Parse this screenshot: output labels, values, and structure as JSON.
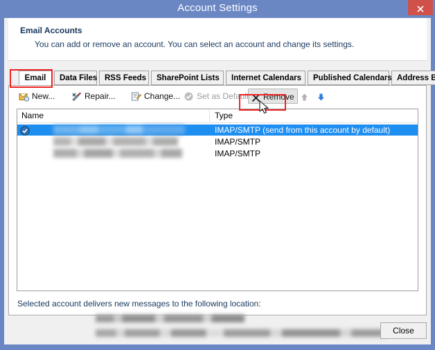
{
  "window": {
    "title": "Account Settings",
    "close_icon": "close-x-icon"
  },
  "header": {
    "title": "Email Accounts",
    "subtitle": "You can add or remove an account. You can select an account and change its settings."
  },
  "tabs": [
    {
      "label": "Email",
      "selected": true
    },
    {
      "label": "Data Files",
      "selected": false
    },
    {
      "label": "RSS Feeds",
      "selected": false
    },
    {
      "label": "SharePoint Lists",
      "selected": false
    },
    {
      "label": "Internet Calendars",
      "selected": false
    },
    {
      "label": "Published Calendars",
      "selected": false
    },
    {
      "label": "Address Books",
      "selected": false
    }
  ],
  "toolbar": {
    "new_label": "New...",
    "repair_label": "Repair...",
    "change_label": "Change...",
    "set_default_label": "Set as Default",
    "remove_label": "Remove",
    "move_up_icon": "arrow-up-icon",
    "move_down_icon": "arrow-down-icon",
    "new_icon": "new-mail-icon",
    "repair_icon": "repair-tools-icon",
    "change_icon": "change-account-icon",
    "set_default_icon": "check-circle-icon",
    "remove_icon": "x-mark-icon"
  },
  "list": {
    "columns": [
      "Name",
      "Type"
    ],
    "rows": [
      {
        "name": "",
        "type": "IMAP/SMTP (send from this account by default)",
        "selected": true,
        "is_default": true,
        "name_redacted": true,
        "name_bar_width": 190
      },
      {
        "name": "",
        "type": "IMAP/SMTP",
        "selected": false,
        "is_default": false,
        "name_redacted": true,
        "name_bar_width": 180
      },
      {
        "name": "",
        "type": "IMAP/SMTP",
        "selected": false,
        "is_default": false,
        "name_redacted": true,
        "name_bar_width": 186
      }
    ]
  },
  "delivery": {
    "label": "Selected account delivers new messages to the following location:",
    "line1_redacted": true,
    "line2_redacted": true
  },
  "footer": {
    "close_label": "Close"
  },
  "annotations": [
    {
      "name": "email-tab-highlight"
    },
    {
      "name": "remove-button-highlight"
    }
  ],
  "colors": {
    "titlebar": "#6a87c4",
    "close_button": "#d0504a",
    "selection": "#1f8ef1",
    "annotation": "#ee2222",
    "header_text": "#17375e",
    "dialog_bg": "#f0f0f0"
  }
}
